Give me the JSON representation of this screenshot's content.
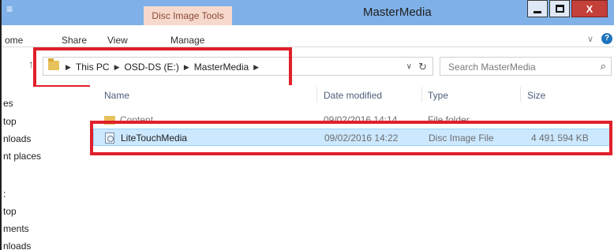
{
  "titlebar": {
    "qat_glyph": "≡",
    "context_tab": "Disc Image Tools",
    "title": "MasterMedia",
    "minimize_label": "—",
    "maximize_label": "□",
    "close_label": "X"
  },
  "ribbon": {
    "tabs": [
      {
        "label": "ome"
      },
      {
        "label": "Share"
      },
      {
        "label": "View"
      },
      {
        "label": "Manage"
      }
    ],
    "expand_glyph": "∨",
    "help_glyph": "?"
  },
  "address": {
    "up_glyph": "↑",
    "crumbs": [
      {
        "label": "This PC"
      },
      {
        "label": "OSD-DS (E:)"
      },
      {
        "label": "MasterMedia"
      }
    ],
    "separator": "▶",
    "dropdown_glyph": "∨",
    "refresh_glyph": "↻"
  },
  "search": {
    "placeholder": "Search MasterMedia",
    "icon_glyph": "⌕"
  },
  "nav": {
    "items": [
      {
        "label": "es"
      },
      {
        "label": "top"
      },
      {
        "label": "nloads"
      },
      {
        "label": "nt places"
      },
      {
        "label": ":"
      },
      {
        "label": "top"
      },
      {
        "label": "ments"
      },
      {
        "label": "nloads"
      }
    ]
  },
  "columns": {
    "name": "Name",
    "date": "Date modified",
    "type": "Type",
    "size": "Size"
  },
  "files": [
    {
      "name": "Content",
      "date": "09/02/2016 14:14",
      "type": "File folder",
      "size": "",
      "icon": "folder-icon"
    },
    {
      "name": "LiteTouchMedia",
      "date": "09/02/2016 14:22",
      "type": "Disc Image File",
      "size": "4 491 594 KB",
      "icon": "disc-image-icon"
    }
  ],
  "colors": {
    "titlebar": "#7fb1e8",
    "context_tab": "#f6d9cc",
    "highlight_box": "#e0202a",
    "selection": "#cce8ff"
  }
}
